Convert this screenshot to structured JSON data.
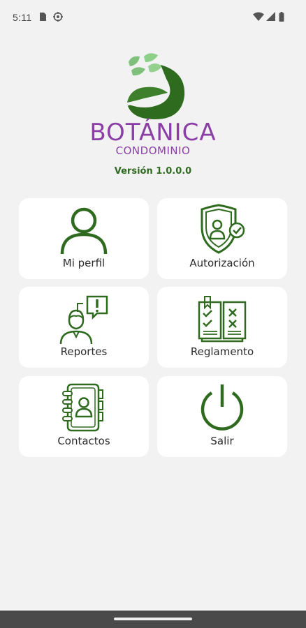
{
  "status_bar": {
    "time": "5:11",
    "left_icons": [
      "sim-card-icon",
      "settings-target-icon"
    ],
    "right_icons": [
      "wifi-icon",
      "signal-icon",
      "battery-icon"
    ]
  },
  "brand": {
    "title": "BOTÁNICA",
    "subtitle": "CONDOMINIO",
    "version": "Versión 1.0.0.0",
    "colors": {
      "purple": "#8b3fa6",
      "green": "#2f6b1f",
      "leaf_light": "#7fc07a"
    }
  },
  "menu": [
    {
      "label": "Mi perfil",
      "icon": "user-profile-icon"
    },
    {
      "label": "Autorización",
      "icon": "shield-user-check-icon"
    },
    {
      "label": "Reportes",
      "icon": "report-person-alert-icon"
    },
    {
      "label": "Reglamento",
      "icon": "rules-book-icon"
    },
    {
      "label": "Contactos",
      "icon": "contacts-book-icon"
    },
    {
      "label": "Salir",
      "icon": "power-icon"
    }
  ]
}
